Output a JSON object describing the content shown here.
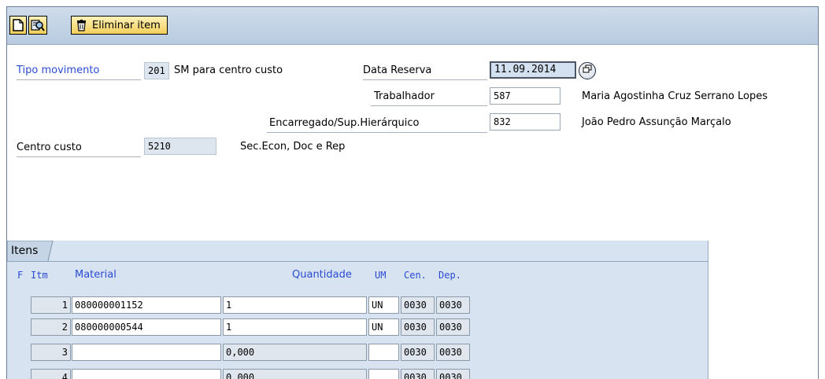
{
  "toolbar": {
    "delete_label": "Eliminar item"
  },
  "header": {
    "movement_type_label": "Tipo movimento",
    "movement_type_value": "201",
    "movement_type_text": "SM para centro custo",
    "reservation_date_label": "Data Reserva",
    "reservation_date_value": "11.09.2014",
    "worker_label": "Trabalhador",
    "worker_value": "587",
    "worker_name": "Maria Agostinha Cruz Serrano Lopes",
    "supervisor_label": "Encarregado/Sup.Hierárquico",
    "supervisor_value": "832",
    "supervisor_name": "João Pedro Assunção Marçalo",
    "cost_center_label": "Centro custo",
    "cost_center_value": "5210",
    "cost_center_text": "Sec.Econ, Doc e Rep"
  },
  "items": {
    "title": "Itens",
    "columns": {
      "f": "F",
      "itm": "Itm",
      "material": "Material",
      "quantity": "Quantidade",
      "um": "UM",
      "cen": "Cen.",
      "dep": "Dep."
    },
    "rows": [
      {
        "itm": "1",
        "material": "080000001152",
        "quantity": "1",
        "um": "UN",
        "cen": "0030",
        "dep": "0030"
      },
      {
        "itm": "2",
        "material": "080000000544",
        "quantity": "1",
        "um": "UN",
        "cen": "0030",
        "dep": "0030"
      },
      {
        "itm": "3",
        "material": "",
        "quantity": "0,000",
        "um": "",
        "cen": "0030",
        "dep": "0030"
      },
      {
        "itm": "4",
        "material": "",
        "quantity": "0,000",
        "um": "",
        "cen": "0030",
        "dep": "0030"
      }
    ]
  },
  "icons": [
    "new-document-icon",
    "find-icon",
    "trash-icon",
    "value-help-icon"
  ],
  "colors": {
    "toolbar_bg": "#c4d4e6",
    "label_blue": "#2a4cd4",
    "button_yellow": "#f3cf5a",
    "table_bg": "#d7e3f0"
  }
}
